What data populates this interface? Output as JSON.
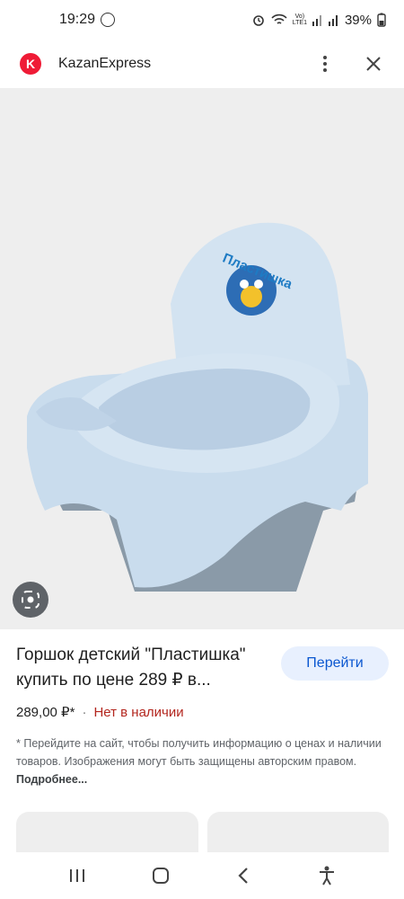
{
  "status_bar": {
    "time": "19:29",
    "network_label_top": "Vo)",
    "network_label_bottom": "LTE1",
    "battery": "39%"
  },
  "app_header": {
    "logo_letter": "K",
    "title": "KazanExpress"
  },
  "product": {
    "title": "Горшок детский \"Пластишка\" купить по цене 289 ₽ в...",
    "go_button_label": "Перейти",
    "price": "289,00 ₽*",
    "separator": "·",
    "stock_status": "Нет в наличии",
    "disclaimer": "* Перейдите на сайт, чтобы получить информацию о ценах и наличии товаров. Изображения могут быть защищены авторским правом.",
    "more_link": "Подробнее...",
    "potty_logo_text": "Пластишка"
  },
  "icons": {
    "lens": "google-lens-icon",
    "menu": "more-vert-icon",
    "close": "close-icon",
    "recent": "recent-apps-icon",
    "home": "home-icon",
    "back": "back-icon",
    "accessibility": "accessibility-icon"
  },
  "colors": {
    "brand_logo": "#ef1b36",
    "go_button_bg": "#e8f0fe",
    "go_button_text": "#0b57d0",
    "out_of_stock": "#b3261e",
    "image_bg": "#eeeeee",
    "potty": "#c9dced"
  }
}
